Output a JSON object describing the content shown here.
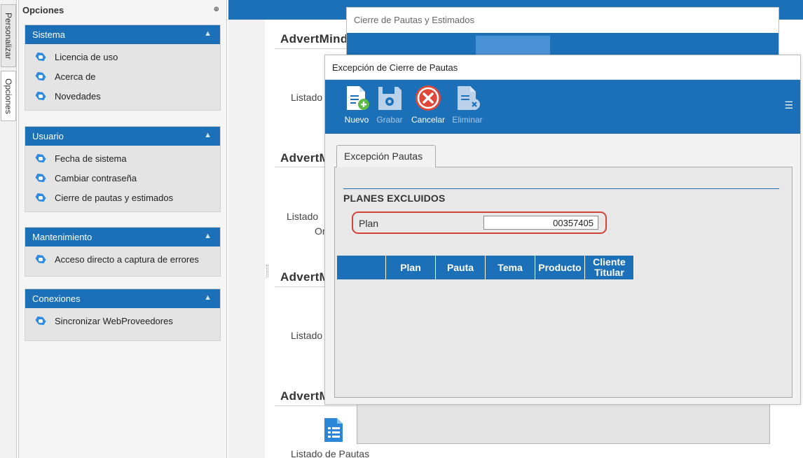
{
  "side_tabs": [
    "Personalizar",
    "Opciones"
  ],
  "panel": {
    "title": "Opciones",
    "groups": [
      {
        "title": "Sistema",
        "items": [
          "Licencia de uso",
          "Acerca de",
          "Novedades"
        ]
      },
      {
        "title": "Usuario",
        "items": [
          "Fecha de sistema",
          "Cambiar contraseña",
          "Cierre de pautas y estimados"
        ]
      },
      {
        "title": "Mantenimiento",
        "items": [
          "Acceso directo a captura de errores"
        ]
      },
      {
        "title": "Conexiones",
        "items": [
          "Sincronizar WebProveedores"
        ]
      }
    ]
  },
  "background": {
    "sections": [
      {
        "title": "AdvertMind",
        "label": "Listado"
      },
      {
        "title": "AdvertM",
        "label": "Listado",
        "label2": "Or"
      },
      {
        "title": "AdvertM",
        "label": "Listado"
      },
      {
        "title": "AdvertM",
        "label": "Listado de Pautas"
      }
    ]
  },
  "window1": {
    "title": "Cierre de Pautas y Estimados"
  },
  "window2": {
    "title": "Excepción de Cierre de Pautas",
    "toolbar": [
      {
        "label": "Nuevo",
        "icon": "new-document-icon",
        "enabled": true
      },
      {
        "label": "Grabar",
        "icon": "save-icon",
        "enabled": false
      },
      {
        "label": "Cancelar",
        "icon": "cancel-icon",
        "enabled": true
      },
      {
        "label": "Eliminar",
        "icon": "delete-document-icon",
        "enabled": false
      }
    ],
    "tab": "Excepción Pautas",
    "section_title": "PLANES EXCLUIDOS",
    "plan": {
      "label": "Plan",
      "value": "00357405"
    },
    "grid_columns": [
      "",
      "Plan",
      "Pauta",
      "Tema",
      "Producto",
      "Cliente\nTitular"
    ]
  },
  "colors": {
    "accent": "#1b70b8",
    "highlight_border": "#d2433a"
  }
}
